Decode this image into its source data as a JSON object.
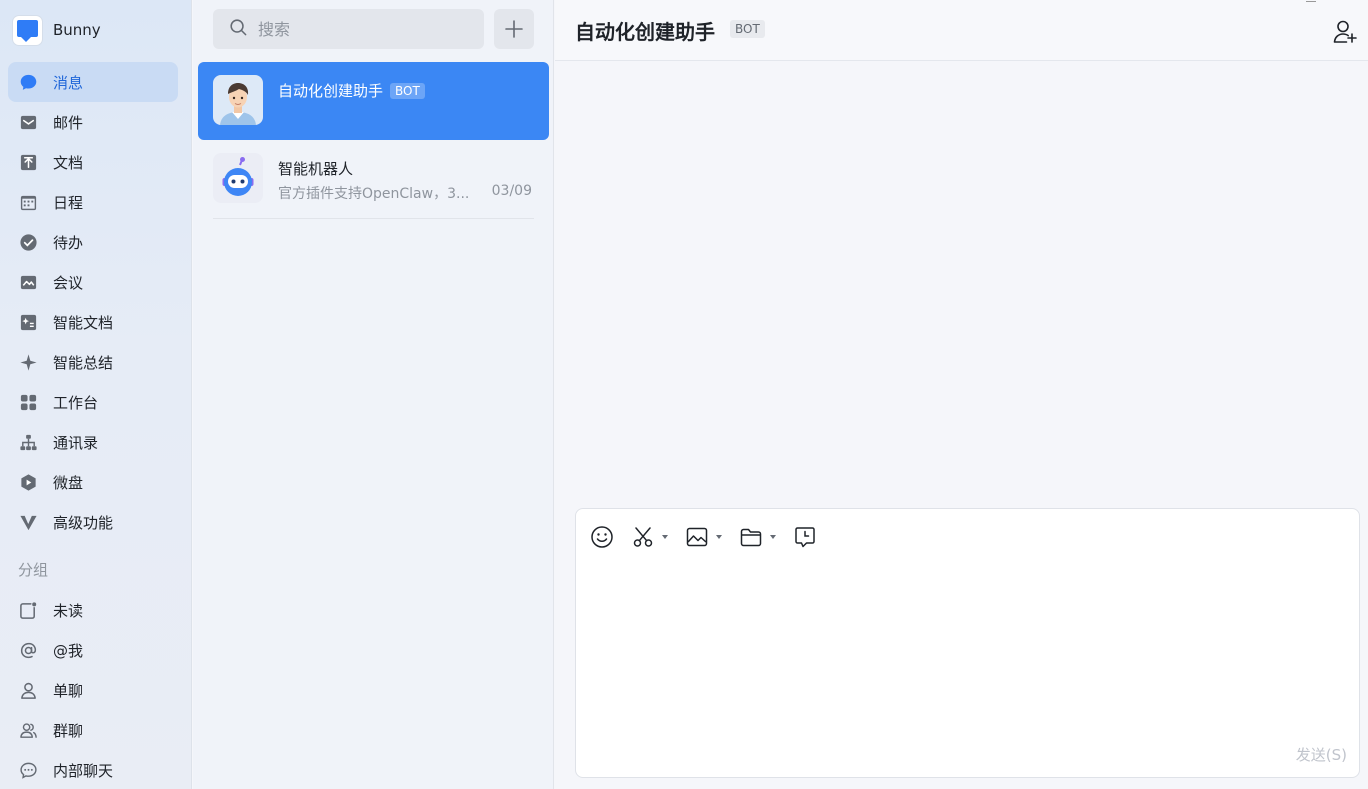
{
  "app": {
    "name": "Bunny"
  },
  "sidebar": {
    "items": [
      {
        "label": "消息",
        "icon": "chat-bubble-icon"
      },
      {
        "label": "邮件",
        "icon": "mail-icon"
      },
      {
        "label": "文档",
        "icon": "document-icon"
      },
      {
        "label": "日程",
        "icon": "calendar-icon"
      },
      {
        "label": "待办",
        "icon": "check-circle-icon"
      },
      {
        "label": "会议",
        "icon": "meeting-icon"
      },
      {
        "label": "智能文档",
        "icon": "smart-doc-icon"
      },
      {
        "label": "智能总结",
        "icon": "sparkle-icon"
      },
      {
        "label": "工作台",
        "icon": "grid-icon"
      },
      {
        "label": "通讯录",
        "icon": "org-chart-icon"
      },
      {
        "label": "微盘",
        "icon": "cloud-drive-icon"
      },
      {
        "label": "高级功能",
        "icon": "v-logo-icon"
      }
    ],
    "group_title": "分组",
    "groups": [
      {
        "label": "未读",
        "icon": "unread-icon"
      },
      {
        "label": "@我",
        "icon": "at-icon"
      },
      {
        "label": "单聊",
        "icon": "person-icon"
      },
      {
        "label": "群聊",
        "icon": "group-icon"
      },
      {
        "label": "内部聊天",
        "icon": "internal-chat-icon"
      }
    ]
  },
  "search": {
    "placeholder": "搜索"
  },
  "conversations": [
    {
      "title": "自动化创建助手",
      "badge": "BOT",
      "preview": "",
      "time": "",
      "active": true
    },
    {
      "title": "智能机器人",
      "badge": "",
      "preview": "官方插件支持OpenClaw，3...",
      "time": "03/09",
      "active": false
    }
  ],
  "chat": {
    "title": "自动化创建助手",
    "badge": "BOT",
    "send_label": "发送(S)"
  },
  "colors": {
    "accent": "#3b87f4",
    "sidebar_active": "#c9dbf4"
  }
}
